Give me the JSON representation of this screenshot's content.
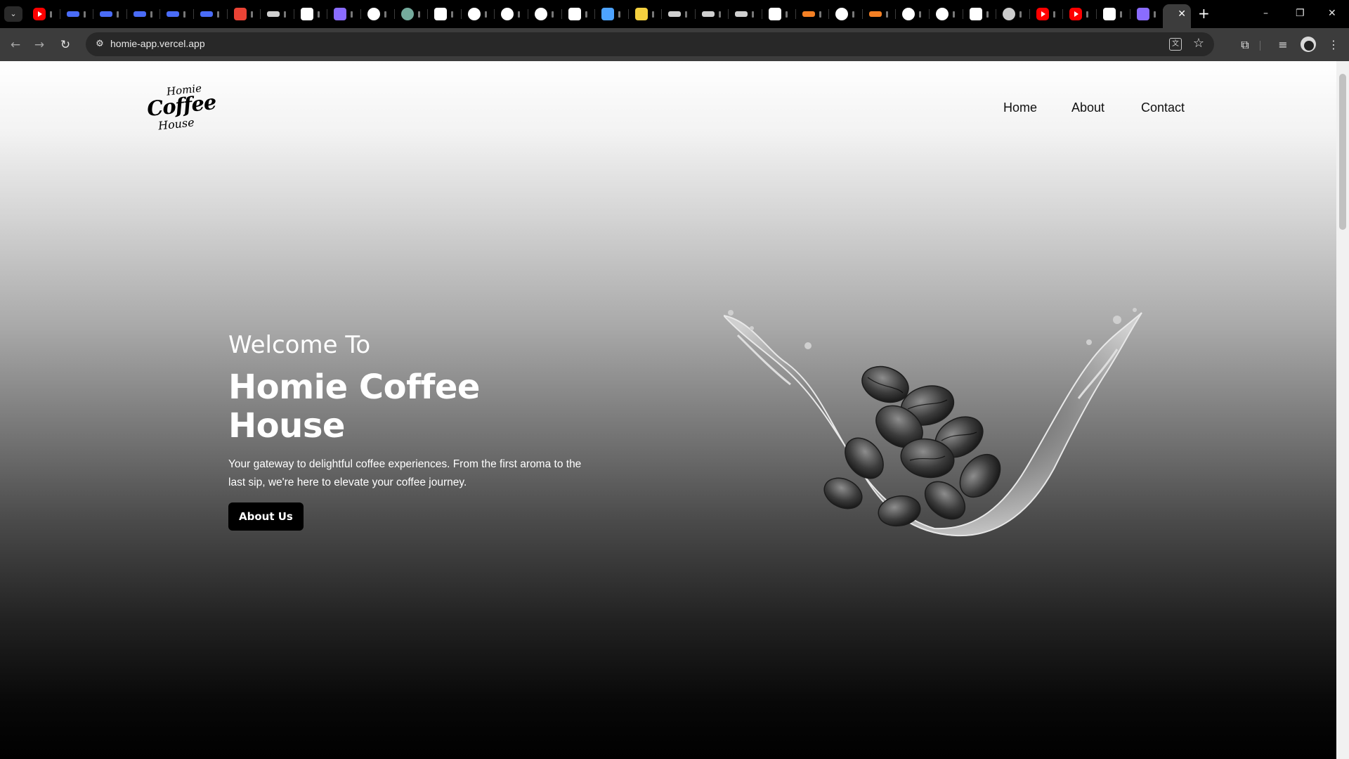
{
  "browser": {
    "url": "homie-app.vercel.app",
    "active_tab_close": "✕",
    "new_tab": "+",
    "controls": {
      "minimize": "–",
      "restore": "❐",
      "close": "✕"
    },
    "tab_favicons": [
      "youtube",
      "link",
      "link",
      "link",
      "link",
      "link",
      "gmail",
      "app",
      "vercel",
      "notion",
      "github",
      "chatgpt",
      "vercel",
      "google",
      "github",
      "github",
      "medium",
      "figma",
      "bootstrap",
      "app",
      "app",
      "app",
      "x",
      "stack",
      "github",
      "stack",
      "github",
      "google",
      "x",
      "web",
      "youtube",
      "youtube",
      "vercel",
      "notion"
    ]
  },
  "site": {
    "logo": {
      "line1": "Homie",
      "line2": "Coffee",
      "line3": "House"
    },
    "nav": {
      "home": "Home",
      "about": "About",
      "contact": "Contact"
    },
    "hero": {
      "subtitle": "Welcome To",
      "title": "Homie Coffee House",
      "description": "Your gateway to delightful coffee experiences. From the first aroma to the last sip, we're here to elevate your coffee journey.",
      "button": "About Us"
    }
  }
}
